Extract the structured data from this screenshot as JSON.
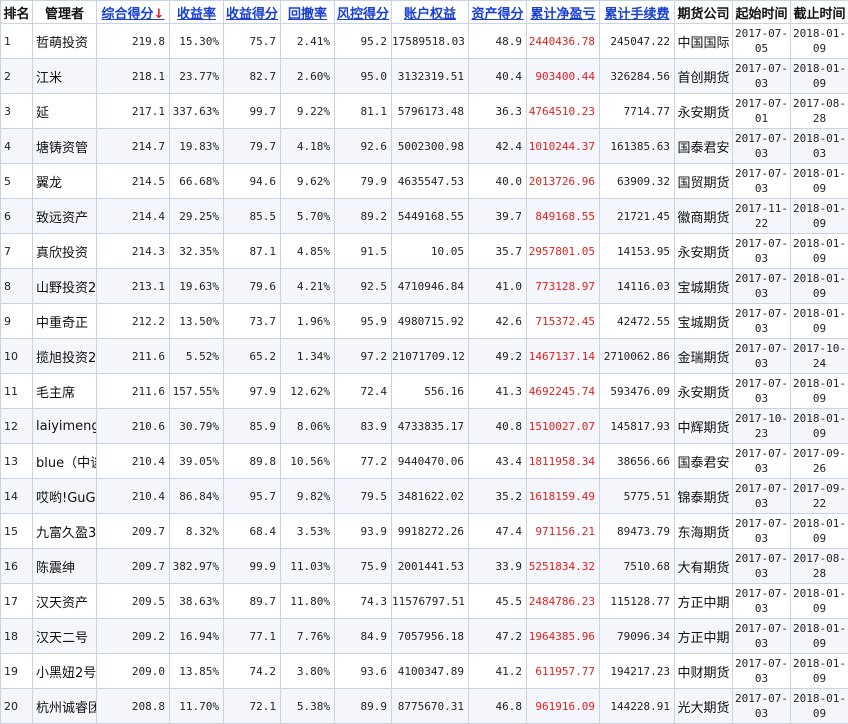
{
  "table": {
    "columns": [
      {
        "label": "排名",
        "sortable": false
      },
      {
        "label": "管理者",
        "sortable": false
      },
      {
        "label": "综合得分",
        "sortable": true,
        "sorted": true
      },
      {
        "label": "收益率",
        "sortable": true
      },
      {
        "label": "收益得分",
        "sortable": true
      },
      {
        "label": "回撤率",
        "sortable": true
      },
      {
        "label": "风控得分",
        "sortable": true
      },
      {
        "label": "账户权益",
        "sortable": true
      },
      {
        "label": "资产得分",
        "sortable": true
      },
      {
        "label": "累计净盈亏",
        "sortable": true
      },
      {
        "label": "累计手续费",
        "sortable": true
      },
      {
        "label": "期货公司",
        "sortable": false
      },
      {
        "label": "起始时间",
        "sortable": false
      },
      {
        "label": "截止时间",
        "sortable": false
      }
    ],
    "sort_arrow": "↓",
    "rows": [
      {
        "rank": "1",
        "manager": "哲萌投资",
        "score": "219.8",
        "return": "15.30%",
        "return_score": "75.7",
        "drawdown": "2.41%",
        "risk_score": "95.2",
        "equity": "17589518.03",
        "asset_score": "48.9",
        "net_pnl": "2440436.78",
        "fees": "245047.22",
        "company": "中国国际",
        "start": "2017-07-05",
        "end": "2018-01-09"
      },
      {
        "rank": "2",
        "manager": "江米",
        "score": "218.1",
        "return": "23.77%",
        "return_score": "82.7",
        "drawdown": "2.60%",
        "risk_score": "95.0",
        "equity": "3132319.51",
        "asset_score": "40.4",
        "net_pnl": "903400.44",
        "fees": "326284.56",
        "company": "首创期货",
        "start": "2017-07-03",
        "end": "2018-01-09"
      },
      {
        "rank": "3",
        "manager": "延",
        "score": "217.1",
        "return": "337.63%",
        "return_score": "99.7",
        "drawdown": "9.22%",
        "risk_score": "81.1",
        "equity": "5796173.48",
        "asset_score": "36.3",
        "net_pnl": "4764510.23",
        "fees": "7714.77",
        "company": "永安期货",
        "start": "2017-07-01",
        "end": "2017-08-28"
      },
      {
        "rank": "4",
        "manager": "塘铸资管",
        "score": "214.7",
        "return": "19.83%",
        "return_score": "79.7",
        "drawdown": "4.18%",
        "risk_score": "92.6",
        "equity": "5002300.98",
        "asset_score": "42.4",
        "net_pnl": "1010244.37",
        "fees": "161385.63",
        "company": "国泰君安",
        "start": "2017-07-03",
        "end": "2018-01-03"
      },
      {
        "rank": "5",
        "manager": "翼龙",
        "score": "214.5",
        "return": "66.68%",
        "return_score": "94.6",
        "drawdown": "9.62%",
        "risk_score": "79.9",
        "equity": "4635547.53",
        "asset_score": "40.0",
        "net_pnl": "2013726.96",
        "fees": "63909.32",
        "company": "国贸期货",
        "start": "2017-07-03",
        "end": "2018-01-09"
      },
      {
        "rank": "6",
        "manager": "致远资产",
        "score": "214.4",
        "return": "29.25%",
        "return_score": "85.5",
        "drawdown": "5.70%",
        "risk_score": "89.2",
        "equity": "5449168.55",
        "asset_score": "39.7",
        "net_pnl": "849168.55",
        "fees": "21721.45",
        "company": "徽商期货",
        "start": "2017-11-22",
        "end": "2018-01-09"
      },
      {
        "rank": "7",
        "manager": "真欣投资",
        "score": "214.3",
        "return": "32.35%",
        "return_score": "87.1",
        "drawdown": "4.85%",
        "risk_score": "91.5",
        "equity": "10.05",
        "asset_score": "35.7",
        "net_pnl": "2957801.05",
        "fees": "14153.95",
        "company": "永安期货",
        "start": "2017-07-03",
        "end": "2018-01-09"
      },
      {
        "rank": "8",
        "manager": "山野投资2",
        "score": "213.1",
        "return": "19.63%",
        "return_score": "79.6",
        "drawdown": "4.21%",
        "risk_score": "92.5",
        "equity": "4710946.84",
        "asset_score": "41.0",
        "net_pnl": "773128.97",
        "fees": "14116.03",
        "company": "宝城期货",
        "start": "2017-07-03",
        "end": "2018-01-09"
      },
      {
        "rank": "9",
        "manager": "中重奇正",
        "score": "212.2",
        "return": "13.50%",
        "return_score": "73.7",
        "drawdown": "1.96%",
        "risk_score": "95.9",
        "equity": "4980715.92",
        "asset_score": "42.6",
        "net_pnl": "715372.45",
        "fees": "42472.55",
        "company": "宝城期货",
        "start": "2017-07-03",
        "end": "2018-01-09"
      },
      {
        "rank": "10",
        "manager": "揽旭投资2",
        "score": "211.6",
        "return": "5.52%",
        "return_score": "65.2",
        "drawdown": "1.34%",
        "risk_score": "97.2",
        "equity": "21071709.12",
        "asset_score": "49.2",
        "net_pnl": "1467137.14",
        "fees": "2710062.86",
        "company": "金瑞期货",
        "start": "2017-07-03",
        "end": "2017-10-24"
      },
      {
        "rank": "11",
        "manager": "毛主席",
        "score": "211.6",
        "return": "157.55%",
        "return_score": "97.9",
        "drawdown": "12.62%",
        "risk_score": "72.4",
        "equity": "556.16",
        "asset_score": "41.3",
        "net_pnl": "4692245.74",
        "fees": "593476.09",
        "company": "永安期货",
        "start": "2017-07-03",
        "end": "2018-01-09"
      },
      {
        "rank": "12",
        "manager": "laiyimeng",
        "score": "210.6",
        "return": "30.79%",
        "return_score": "85.9",
        "drawdown": "8.06%",
        "risk_score": "83.9",
        "equity": "4733835.17",
        "asset_score": "40.8",
        "net_pnl": "1510027.07",
        "fees": "145817.93",
        "company": "中辉期货",
        "start": "2017-10-23",
        "end": "2018-01-09"
      },
      {
        "rank": "13",
        "manager": "blue（中谈",
        "score": "210.4",
        "return": "39.05%",
        "return_score": "89.8",
        "drawdown": "10.56%",
        "risk_score": "77.2",
        "equity": "9440470.06",
        "asset_score": "43.4",
        "net_pnl": "1811958.34",
        "fees": "38656.66",
        "company": "国泰君安",
        "start": "2017-07-03",
        "end": "2017-09-26"
      },
      {
        "rank": "14",
        "manager": "哎哟!GuGu",
        "score": "210.4",
        "return": "86.84%",
        "return_score": "95.7",
        "drawdown": "9.82%",
        "risk_score": "79.5",
        "equity": "3481622.02",
        "asset_score": "35.2",
        "net_pnl": "1618159.49",
        "fees": "5775.51",
        "company": "锦泰期货",
        "start": "2017-07-03",
        "end": "2017-09-22"
      },
      {
        "rank": "15",
        "manager": "九富久盈3",
        "score": "209.7",
        "return": "8.32%",
        "return_score": "68.4",
        "drawdown": "3.53%",
        "risk_score": "93.9",
        "equity": "9918272.26",
        "asset_score": "47.4",
        "net_pnl": "971156.21",
        "fees": "89473.79",
        "company": "东海期货",
        "start": "2017-07-03",
        "end": "2018-01-09"
      },
      {
        "rank": "16",
        "manager": "陈震绅",
        "score": "209.7",
        "return": "382.97%",
        "return_score": "99.9",
        "drawdown": "11.03%",
        "risk_score": "75.9",
        "equity": "2001441.53",
        "asset_score": "33.9",
        "net_pnl": "5251834.32",
        "fees": "7510.68",
        "company": "大有期货",
        "start": "2017-07-03",
        "end": "2017-08-28"
      },
      {
        "rank": "17",
        "manager": "汉天资产",
        "score": "209.5",
        "return": "38.63%",
        "return_score": "89.7",
        "drawdown": "11.80%",
        "risk_score": "74.3",
        "equity": "11576797.51",
        "asset_score": "45.5",
        "net_pnl": "2484786.23",
        "fees": "115128.77",
        "company": "方正中期",
        "start": "2017-07-03",
        "end": "2018-01-09"
      },
      {
        "rank": "18",
        "manager": "汉天二号",
        "score": "209.2",
        "return": "16.94%",
        "return_score": "77.1",
        "drawdown": "7.76%",
        "risk_score": "84.9",
        "equity": "7057956.18",
        "asset_score": "47.2",
        "net_pnl": "1964385.96",
        "fees": "79096.34",
        "company": "方正中期",
        "start": "2017-07-03",
        "end": "2018-01-09"
      },
      {
        "rank": "19",
        "manager": "小黑妞2号",
        "score": "209.0",
        "return": "13.85%",
        "return_score": "74.2",
        "drawdown": "3.80%",
        "risk_score": "93.6",
        "equity": "4100347.89",
        "asset_score": "41.2",
        "net_pnl": "611957.77",
        "fees": "194217.23",
        "company": "中财期货",
        "start": "2017-07-03",
        "end": "2018-01-09"
      },
      {
        "rank": "20",
        "manager": "杭州诚睿团",
        "score": "208.8",
        "return": "11.70%",
        "return_score": "72.1",
        "drawdown": "5.38%",
        "risk_score": "89.9",
        "equity": "8775670.31",
        "asset_score": "46.8",
        "net_pnl": "961916.09",
        "fees": "144228.91",
        "company": "光大期货",
        "start": "2017-07-03",
        "end": "2018-01-09"
      }
    ]
  }
}
